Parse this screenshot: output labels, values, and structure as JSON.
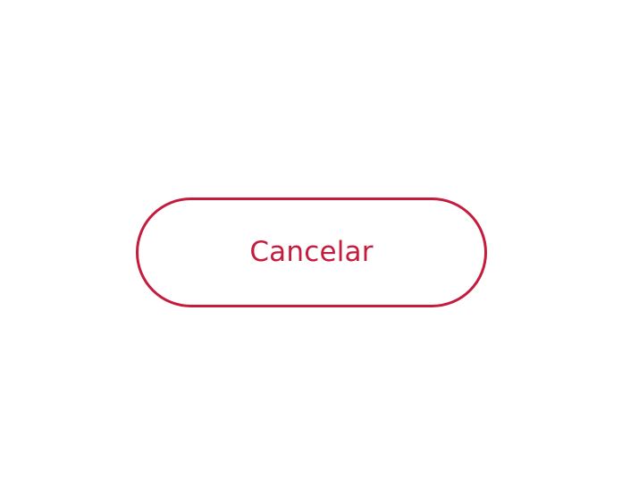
{
  "dialog": {
    "cancel_label": "Cancelar"
  },
  "colors": {
    "accent": "#c51c3e",
    "background": "#ffffff"
  }
}
